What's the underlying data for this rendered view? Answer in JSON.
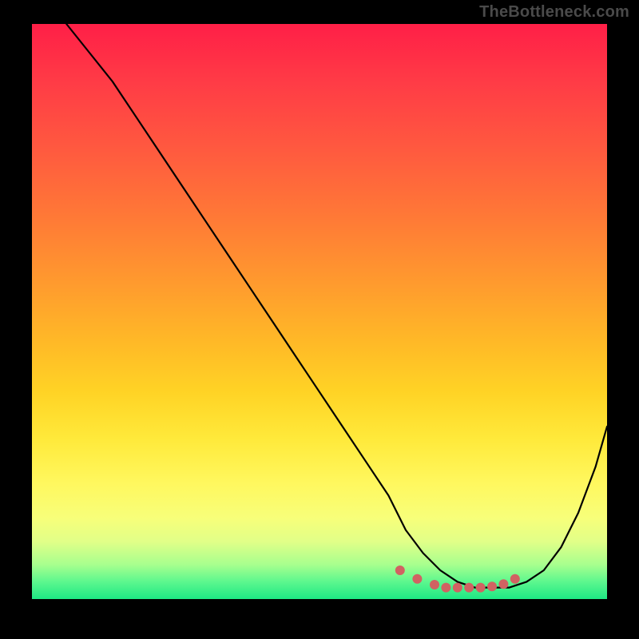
{
  "watermark": "TheBottleneck.com",
  "chart_data": {
    "type": "line",
    "title": "",
    "xlabel": "",
    "ylabel": "",
    "xlim": [
      0,
      100
    ],
    "ylim": [
      0,
      100
    ],
    "grid": false,
    "series": [
      {
        "name": "bottleneck-curve",
        "x": [
          6,
          10,
          14,
          18,
          22,
          26,
          30,
          34,
          38,
          42,
          46,
          50,
          54,
          58,
          62,
          65,
          68,
          71,
          74,
          77,
          80,
          83,
          86,
          89,
          92,
          95,
          98,
          100
        ],
        "y": [
          100,
          95,
          90,
          84,
          78,
          72,
          66,
          60,
          54,
          48,
          42,
          36,
          30,
          24,
          18,
          12,
          8,
          5,
          3,
          2,
          2,
          2,
          3,
          5,
          9,
          15,
          23,
          30
        ]
      }
    ],
    "highlight_points": {
      "name": "optimal-range-dots",
      "x": [
        64,
        67,
        70,
        72,
        74,
        76,
        78,
        80,
        82,
        84
      ],
      "y": [
        5,
        3.5,
        2.5,
        2,
        2,
        2,
        2,
        2.2,
        2.6,
        3.5
      ]
    },
    "gradient_stops": [
      {
        "pos": 0,
        "color": "#ff1f47"
      },
      {
        "pos": 50,
        "color": "#ffb827"
      },
      {
        "pos": 80,
        "color": "#fff85f"
      },
      {
        "pos": 100,
        "color": "#1ee884"
      }
    ]
  }
}
